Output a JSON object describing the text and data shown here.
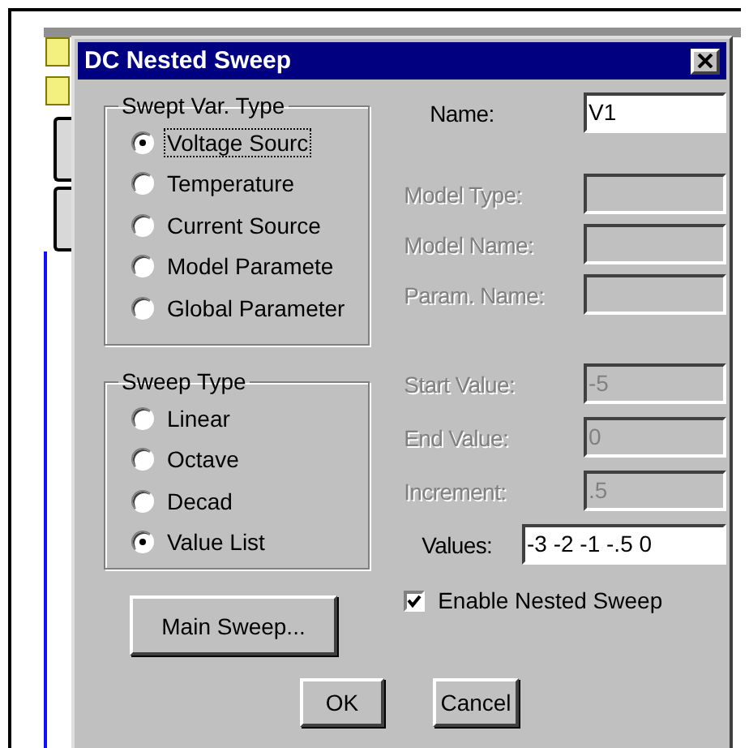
{
  "window": {
    "title": "DC Nested Sweep"
  },
  "swept_var_type": {
    "label": "Swept Var. Type",
    "options": [
      {
        "label": "Voltage Sourc",
        "selected": true,
        "focused": true
      },
      {
        "label": "Temperature",
        "selected": false,
        "focused": false
      },
      {
        "label": "Current Source",
        "selected": false,
        "focused": false
      },
      {
        "label": "Model Paramete",
        "selected": false,
        "focused": false
      },
      {
        "label": "Global Parameter",
        "selected": false,
        "focused": false
      }
    ]
  },
  "sweep_type": {
    "label": "Sweep Type",
    "options": [
      {
        "label": "Linear",
        "selected": false,
        "focused": false
      },
      {
        "label": "Octave",
        "selected": false,
        "focused": false
      },
      {
        "label": "Decad",
        "selected": false,
        "focused": false
      },
      {
        "label": "Value List",
        "selected": true,
        "focused": false
      }
    ]
  },
  "name_fields": [
    {
      "label": "Name:",
      "value": "V1",
      "disabled": false
    },
    {
      "label": "Model Type:",
      "disabled": true
    },
    {
      "label": "Model Name:",
      "disabled": true
    },
    {
      "label": "Param. Name:",
      "disabled": true
    }
  ],
  "value_fields": [
    {
      "label": "Start Value:",
      "value": "-5",
      "disabled": true
    },
    {
      "label": "End Value:",
      "value": "0",
      "disabled": true
    },
    {
      "label": "Increment:",
      "value": ".5",
      "disabled": true
    },
    {
      "label": "Values:",
      "value": "-3 -2 -1 -.5 0",
      "disabled": false
    }
  ],
  "main_sweep_button": "Main Sweep...",
  "enable_nested_sweep": {
    "label": "Enable Nested Sweep",
    "checked": true
  },
  "buttons": [
    "OK",
    "Cancel"
  ]
}
